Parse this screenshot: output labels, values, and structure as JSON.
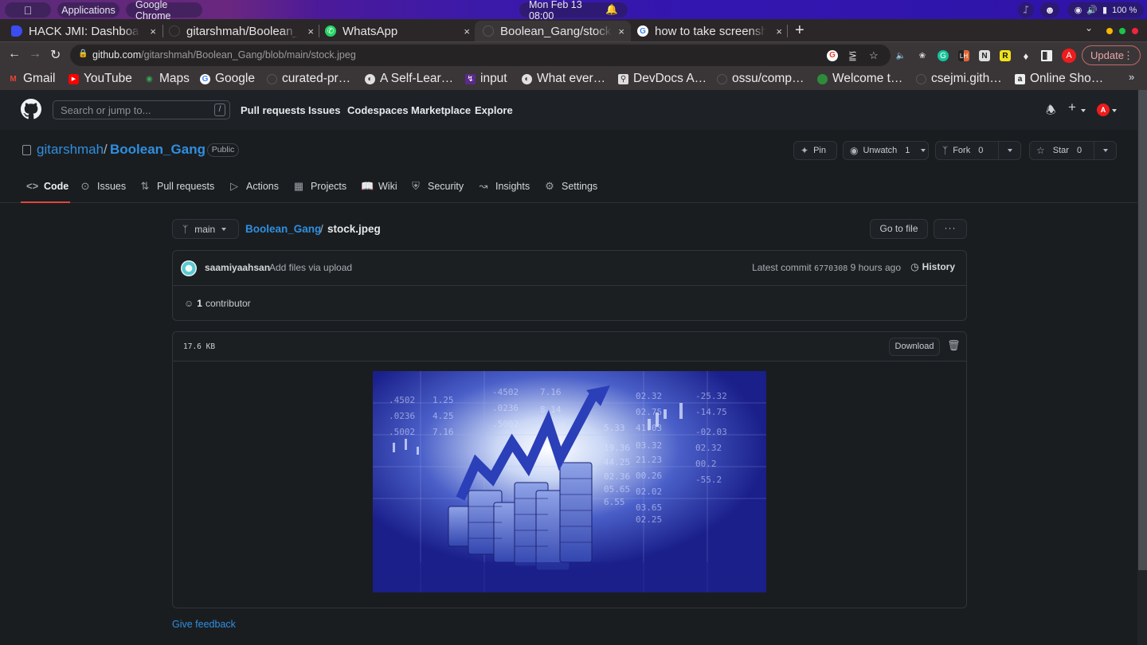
{
  "os": {
    "apple_icon": "apple-icon",
    "applications": "Applications",
    "active_app": "Google Chrome",
    "clock": "Mon Feb 13  08:00",
    "battery": "100 %"
  },
  "browser": {
    "tabs": [
      {
        "title": "HACK JMI: Dashboard",
        "favicon": "hackjmi-icon",
        "active": false
      },
      {
        "title": "gitarshmah/Boolean_Gang",
        "favicon": "github-icon",
        "active": false
      },
      {
        "title": "WhatsApp",
        "favicon": "whatsapp-icon",
        "active": false
      },
      {
        "title": "Boolean_Gang/stock.jpeg",
        "favicon": "github-icon",
        "active": true
      },
      {
        "title": "how to take screenshot",
        "favicon": "google-icon",
        "active": false
      }
    ],
    "close_glyph": "×",
    "new_tab_glyph": "+",
    "url_host": "github.com",
    "url_path": "/gitarshmah/Boolean_Gang/blob/main/stock.jpeg",
    "update_label": "Update",
    "profile_initial": "A",
    "bookmarks": [
      {
        "label": "Gmail",
        "icon": "gmail-icon"
      },
      {
        "label": "YouTube",
        "icon": "youtube-icon"
      },
      {
        "label": "Maps",
        "icon": "maps-icon"
      },
      {
        "label": "Google",
        "icon": "google-icon"
      },
      {
        "label": "curated-pr…",
        "icon": "github-icon"
      },
      {
        "label": "A Self-Lear…",
        "icon": "globe-icon"
      },
      {
        "label": "input",
        "icon": "bolt-icon"
      },
      {
        "label": "What ever…",
        "icon": "globe-icon"
      },
      {
        "label": "DevDocs A…",
        "icon": "devdocs-icon"
      },
      {
        "label": "ossu/comp…",
        "icon": "github-icon"
      },
      {
        "label": "Welcome t…",
        "icon": "frog-icon"
      },
      {
        "label": "csejmi.gith…",
        "icon": "github-icon"
      },
      {
        "label": "Online Sho…",
        "icon": "amazon-icon"
      }
    ],
    "bookmarks_more": "»"
  },
  "github": {
    "search_placeholder": "Search or jump to...",
    "search_shortcut": "/",
    "nav": [
      "Pull requests",
      "Issues",
      "Codespaces",
      "Marketplace",
      "Explore"
    ],
    "user_initial": "A",
    "repo": {
      "owner": "gitarshmah",
      "separator": "/",
      "name": "Boolean_Gang",
      "visibility": "Public",
      "pin_label": "Pin",
      "watch_label": "Unwatch",
      "watch_count": "1",
      "fork_label": "Fork",
      "fork_count": "0",
      "star_label": "Star",
      "star_count": "0"
    },
    "tabs": [
      {
        "label": "Code",
        "icon": "code-icon",
        "active": true
      },
      {
        "label": "Issues",
        "icon": "issue-icon"
      },
      {
        "label": "Pull requests",
        "icon": "pull-request-icon"
      },
      {
        "label": "Actions",
        "icon": "play-icon"
      },
      {
        "label": "Projects",
        "icon": "table-icon"
      },
      {
        "label": "Wiki",
        "icon": "book-icon"
      },
      {
        "label": "Security",
        "icon": "shield-icon"
      },
      {
        "label": "Insights",
        "icon": "graph-icon"
      },
      {
        "label": "Settings",
        "icon": "gear-icon"
      }
    ],
    "file": {
      "branch": "main",
      "breadcrumb_repo": "Boolean_Gang",
      "breadcrumb_sep": "/",
      "filename": "stock.jpeg",
      "goto_label": "Go to file",
      "more_label": "···",
      "commit_author": "saamiyaahsan",
      "commit_message": "Add files via upload",
      "latest_commit_label": "Latest commit",
      "commit_sha": "6770308",
      "commit_time": "9 hours ago",
      "history_label": "History",
      "contributor_count": "1",
      "contributor_label": "contributor",
      "size": "17.6 KB",
      "download_label": "Download",
      "image_alt": "Stock market growth chart with rising arrow and bar stacks"
    },
    "feedback_label": "Give feedback"
  },
  "colors": {
    "link": "#2f8fe0",
    "active_tab_underline": "#e0463a",
    "avatar_red": "#ee1c1c"
  }
}
